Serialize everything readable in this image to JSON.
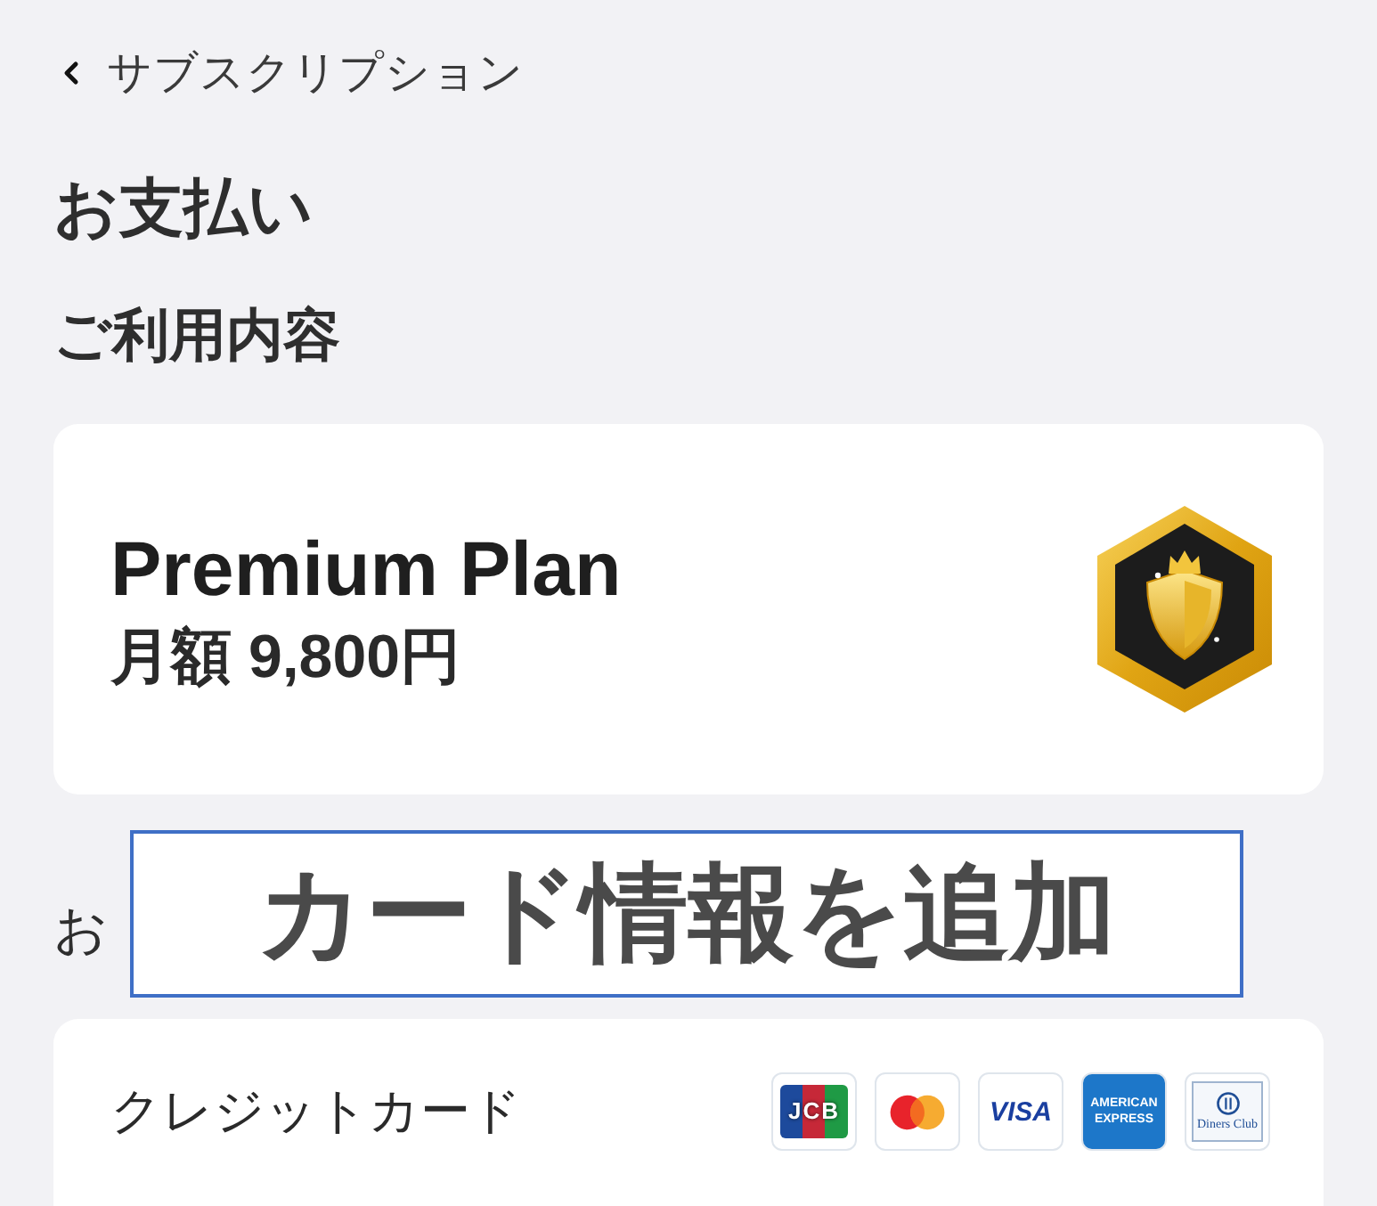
{
  "back_link": {
    "label": "サブスクリプション"
  },
  "page_title": "お支払い",
  "usage_section": {
    "heading": "ご利用内容",
    "plan": {
      "name": "Premium Plan",
      "price": "月額 9,800円"
    }
  },
  "payment_section": {
    "heading": "お",
    "methods": [
      {
        "label": "クレジットカード",
        "brands": [
          {
            "kind": "jcb",
            "label": "JCB"
          },
          {
            "kind": "mastercard"
          },
          {
            "kind": "visa",
            "label": "VISA"
          },
          {
            "kind": "amex",
            "label": "AMERICAN EXPRESS"
          },
          {
            "kind": "diners",
            "label": "Diners Club"
          }
        ]
      }
    ]
  },
  "overlay": {
    "text": "カード情報を追加"
  }
}
